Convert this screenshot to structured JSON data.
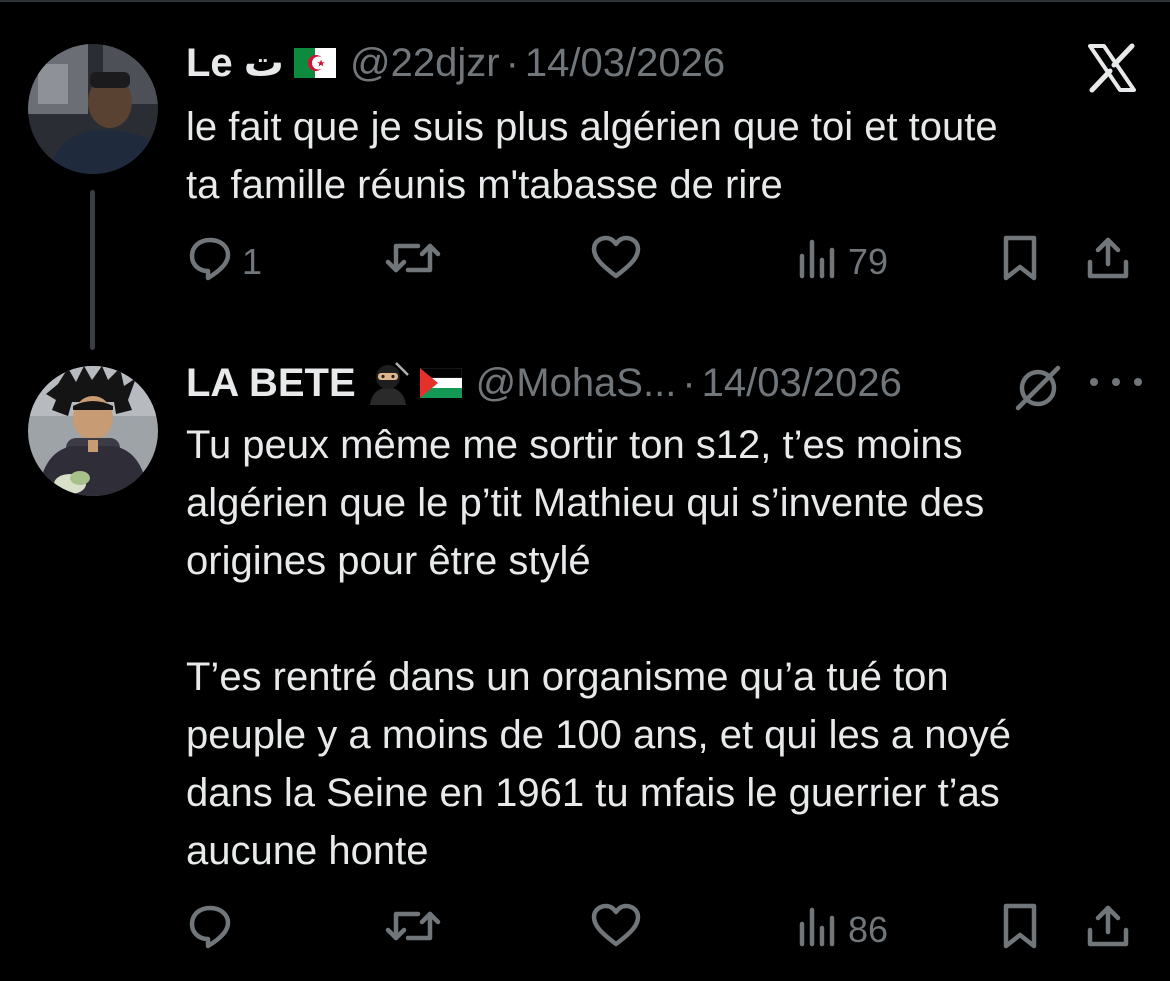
{
  "tweets": [
    {
      "display_name": "Le ت",
      "flag_icon": "algeria-flag-icon",
      "handle": "@22djzr",
      "dot": "·",
      "date": "14/03/2026",
      "text": "le fait que je suis plus algérien que toi et toute\nta famille réunis m'tabasse de rire",
      "replies": "1",
      "retweets": "",
      "likes": "",
      "views": "79"
    },
    {
      "display_name": "LA BETE",
      "emojis": [
        "ninja-emoji-icon",
        "palestine-flag-icon"
      ],
      "handle": "@MohaS...",
      "dot": "·",
      "date": "14/03/2026",
      "text": "Tu peux même me sortir ton s12, t’es moins\nalgérien que le p’tit Mathieu qui s’invente des\norigines pour être stylé\n\nT’es rentré dans un organisme qu’a tué ton\npeuple y a moins de 100 ans, et qui les a noyé\ndans la Seine en 1961 tu mfais le guerrier t’as\naucune honte",
      "replies": "",
      "retweets": "",
      "likes": "",
      "views": "86"
    }
  ],
  "colors": {
    "background": "#000000",
    "text": "#e7e9ea",
    "secondary": "#71767b",
    "thread_line": "#3a3d41"
  },
  "icons": {
    "reply": "reply-icon",
    "retweet": "retweet-icon",
    "like": "heart-icon",
    "views": "views-icon",
    "bookmark": "bookmark-icon",
    "share": "share-icon",
    "x_logo": "x-logo-icon",
    "grok": "grok-icon",
    "more": "more-icon"
  }
}
